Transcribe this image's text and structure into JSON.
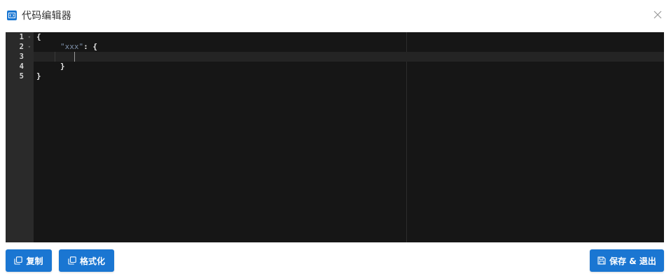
{
  "window": {
    "title": "代码编辑器",
    "title_icon": "code-icon",
    "close_icon": "close-icon"
  },
  "editor": {
    "line_numbers": [
      "1",
      "2",
      "3",
      "4",
      "5"
    ],
    "lines": [
      {
        "open": "{"
      },
      {
        "key": "\"xxx\"",
        "after": ": {"
      },
      {
        "text": ""
      },
      {
        "text": "}"
      },
      {
        "text": "}"
      }
    ],
    "theme": {
      "background": "#161616",
      "gutter": "#2a2a2a",
      "string": "#7d8fa8"
    }
  },
  "buttons": {
    "copy": {
      "label": "复制",
      "icon": "copy-icon"
    },
    "format": {
      "label": "格式化",
      "icon": "format-icon"
    },
    "save": {
      "label": "保存 & 退出",
      "icon": "save-icon"
    }
  },
  "colors": {
    "accent": "#1a76d2"
  }
}
